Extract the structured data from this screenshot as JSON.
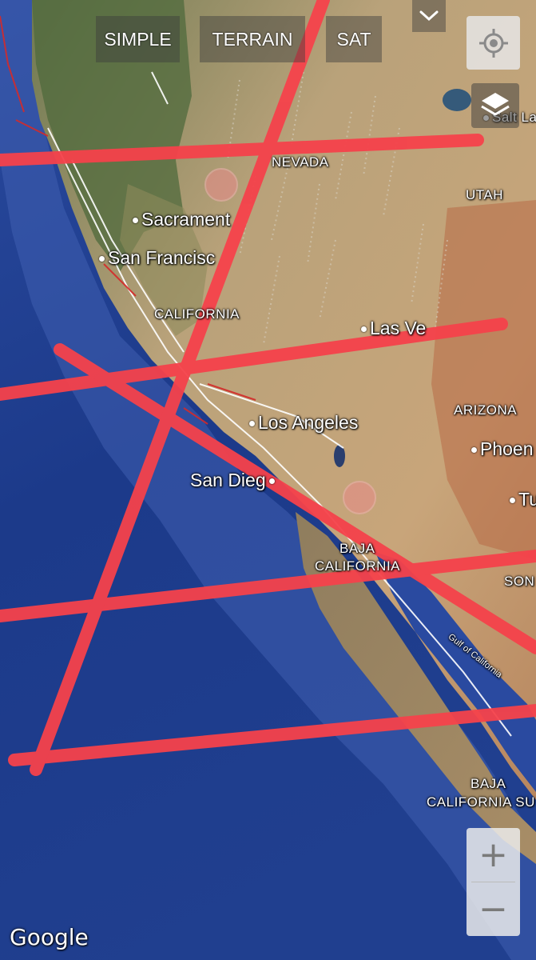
{
  "map_type_buttons": [
    "SIMPLE",
    "TERRAIN",
    "SAT"
  ],
  "labels": {
    "nevada": "NEVADA",
    "utah": "UTAH",
    "salt_lake": "Salt Lak",
    "sacramento": "Sacrament",
    "san_francisco": "San Francisc",
    "california": "CALIFORNIA",
    "las_vegas": "Las Ve",
    "arizona": "ARIZONA",
    "los_angeles": "Los Angeles",
    "phoenix": "Phoen",
    "san_diego": "San Dieg",
    "tucson": "Tu",
    "baja_california_1": "BAJA",
    "baja_california_2": "CALIFORNIA",
    "sonora": "SON",
    "gulf": "Gulf of California",
    "baja_sur_1": "BAJA",
    "baja_sur_2": "CALIFORNIA SU"
  },
  "zoom": {
    "in": "+",
    "out": "−"
  },
  "attribution": "Google",
  "icons": {
    "collapse": "chevron-down-icon",
    "locate": "my-location-icon",
    "layers": "layers-icon"
  },
  "colors": {
    "ocean": "#1f3c8c",
    "land": "#b59a6c",
    "drawn_lines": "#f5424b",
    "fault_lines": "#d42a2a"
  }
}
